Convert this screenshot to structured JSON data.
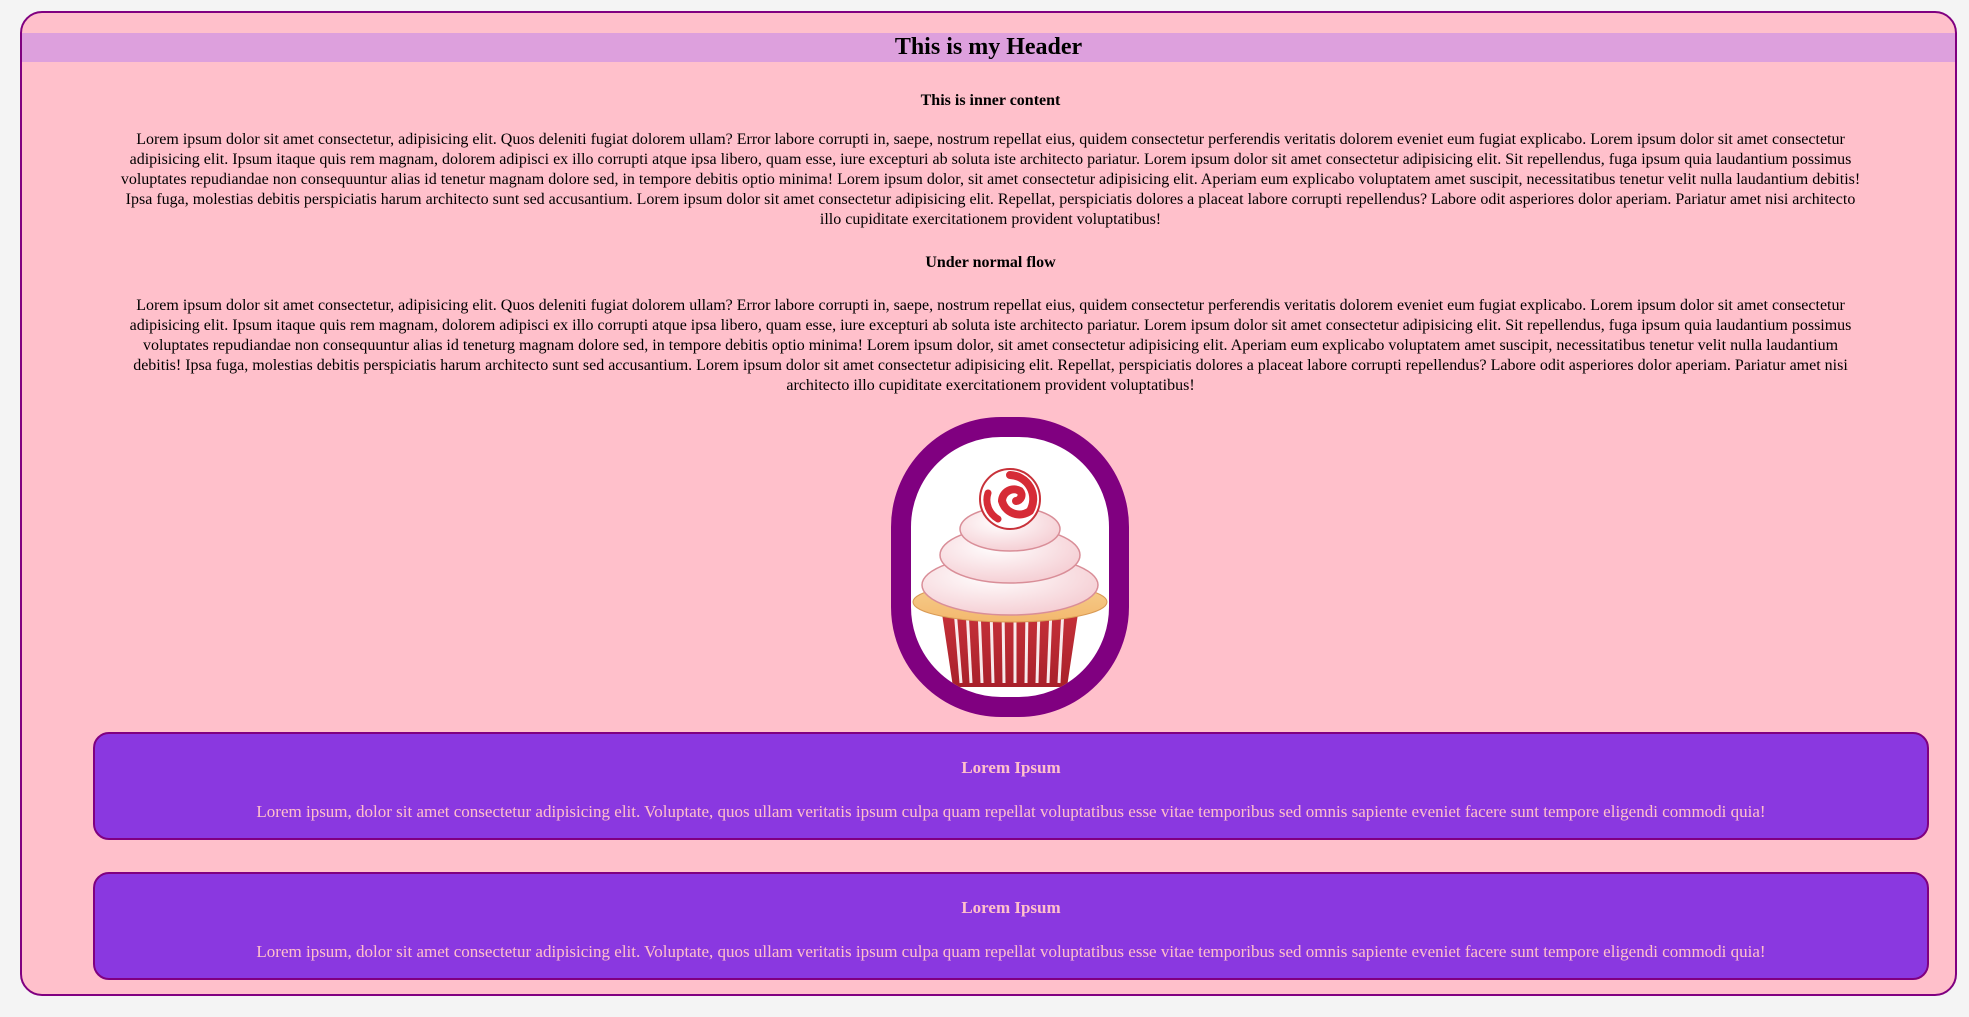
{
  "header": {
    "title": "This is my Header"
  },
  "inner_section": {
    "heading": "This is inner content",
    "paragraph": "Lorem ipsum dolor sit amet consectetur, adipisicing elit. Quos deleniti fugiat dolorem ullam? Error labore corrupti in, saepe, nostrum repellat eius, quidem consectetur perferendis veritatis dolorem eveniet eum fugiat explicabo. Lorem ipsum dolor sit amet consectetur adipisicing elit. Ipsum itaque quis rem magnam, dolorem adipisci ex illo corrupti atque ipsa libero, quam esse, iure excepturi ab soluta iste architecto pariatur. Lorem ipsum dolor sit amet consectetur adipisicing elit. Sit repellendus, fuga ipsum quia laudantium possimus voluptates repudiandae non consequuntur alias id tenetur magnam dolore sed, in tempore debitis optio minima! Lorem ipsum dolor, sit amet consectetur adipisicing elit. Aperiam eum explicabo voluptatem amet suscipit, necessitatibus tenetur velit nulla laudantium debitis! Ipsa fuga, molestias debitis perspiciatis harum architecto sunt sed accusantium. Lorem ipsum dolor sit amet consectetur adipisicing elit. Repellat, perspiciatis dolores a placeat labore corrupti repellendus? Labore odit asperiores dolor aperiam. Pariatur amet nisi architecto illo cupiditate exercitationem provident voluptatibus!"
  },
  "normal_flow_section": {
    "heading": "Under normal flow",
    "paragraph": "Lorem ipsum dolor sit amet consectetur, adipisicing elit. Quos deleniti fugiat dolorem ullam? Error labore corrupti in, saepe, nostrum repellat eius, quidem consectetur perferendis veritatis dolorem eveniet eum fugiat explicabo. Lorem ipsum dolor sit amet consectetur adipisicing elit. Ipsum itaque quis rem magnam, dolorem adipisci ex illo corrupti atque ipsa libero, quam esse, iure excepturi ab soluta iste architecto pariatur. Lorem ipsum dolor sit amet consectetur adipisicing elit. Sit repellendus, fuga ipsum quia laudantium possimus voluptates repudiandae non consequuntur alias id teneturg magnam dolore sed, in tempore debitis optio minima! Lorem ipsum dolor, sit amet consectetur adipisicing elit. Aperiam eum explicabo voluptatem amet suscipit, necessitatibus tenetur velit nulla laudantium debitis! Ipsa fuga, molestias debitis perspiciatis harum architecto sunt sed accusantium. Lorem ipsum dolor sit amet consectetur adipisicing elit. Repellat, perspiciatis dolores a placeat labore corrupti repellendus? Labore odit asperiores dolor aperiam. Pariatur amet nisi architecto illo cupiditate exercitationem provident voluptatibus!"
  },
  "image": {
    "subject": "cupcake-with-swirl-candy",
    "frame_color": "#800080"
  },
  "cards": [
    {
      "title": "Lorem Ipsum",
      "text": "Lorem ipsum, dolor sit amet consectetur adipisicing elit. Voluptate, quos ullam veritatis ipsum culpa quam repellat voluptatibus esse vitae temporibus sed omnis sapiente eveniet facere sunt tempore eligendi commodi quia!"
    },
    {
      "title": "Lorem Ipsum",
      "text": "Lorem ipsum, dolor sit amet consectetur adipisicing elit. Voluptate, quos ullam veritatis ipsum culpa quam repellat voluptatibus esse vitae temporibus sed omnis sapiente eveniet facere sunt tempore eligendi commodi quia!"
    }
  ],
  "colors": {
    "page_background": "#ffc0cb",
    "header_background": "#dda0dd",
    "border": "#800080",
    "card_background": "#8a38e0",
    "card_text": "#ffc0cb"
  }
}
